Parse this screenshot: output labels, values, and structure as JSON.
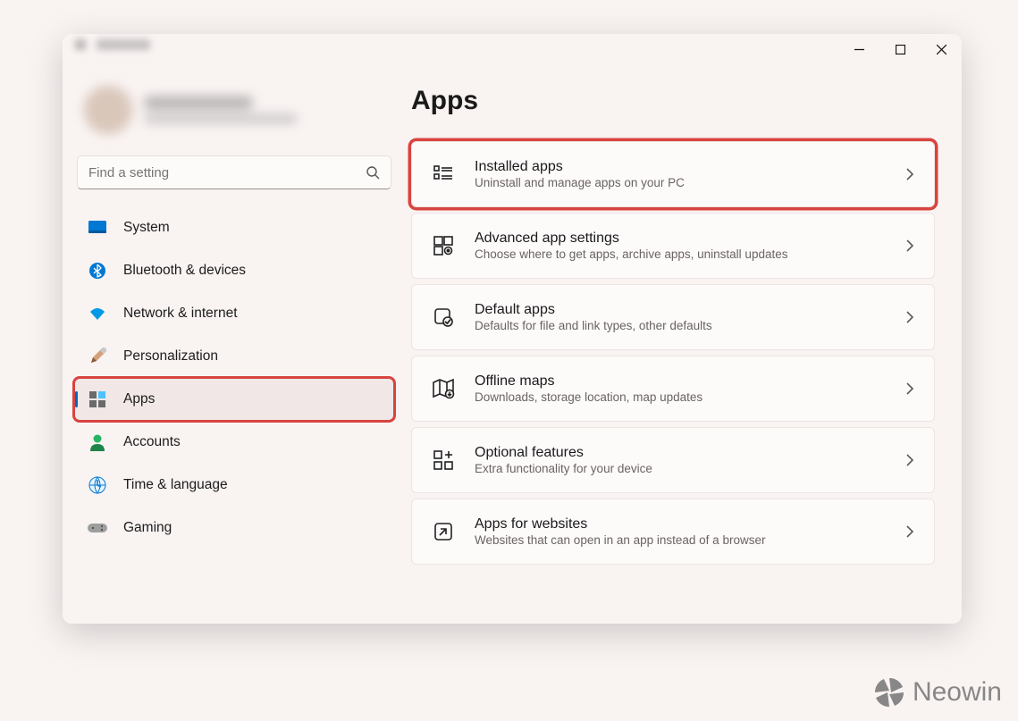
{
  "search": {
    "placeholder": "Find a setting"
  },
  "sidebar": {
    "items": [
      {
        "label": "System"
      },
      {
        "label": "Bluetooth & devices"
      },
      {
        "label": "Network & internet"
      },
      {
        "label": "Personalization"
      },
      {
        "label": "Apps"
      },
      {
        "label": "Accounts"
      },
      {
        "label": "Time & language"
      },
      {
        "label": "Gaming"
      }
    ]
  },
  "page": {
    "title": "Apps"
  },
  "cards": [
    {
      "title": "Installed apps",
      "sub": "Uninstall and manage apps on your PC"
    },
    {
      "title": "Advanced app settings",
      "sub": "Choose where to get apps, archive apps, uninstall updates"
    },
    {
      "title": "Default apps",
      "sub": "Defaults for file and link types, other defaults"
    },
    {
      "title": "Offline maps",
      "sub": "Downloads, storage location, map updates"
    },
    {
      "title": "Optional features",
      "sub": "Extra functionality for your device"
    },
    {
      "title": "Apps for websites",
      "sub": "Websites that can open in an app instead of a browser"
    }
  ],
  "watermark": {
    "text": "Neowin"
  }
}
